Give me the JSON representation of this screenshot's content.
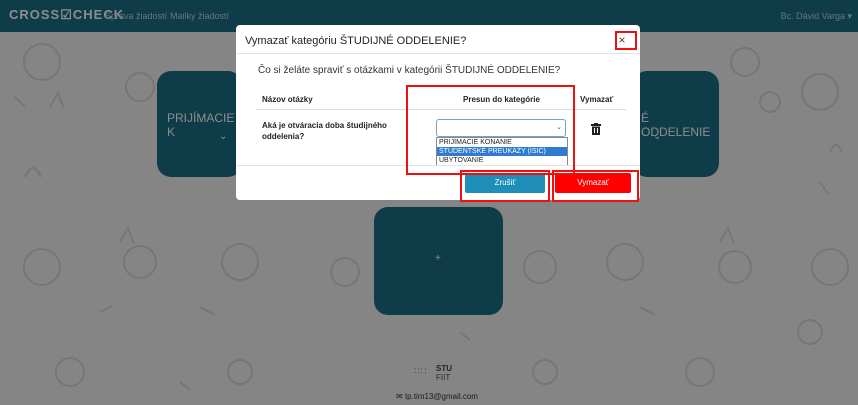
{
  "navbar": {
    "brand": "CROSS☑CHECK",
    "links": [
      "Správa žiadostí",
      "Mailky žiadostí"
    ],
    "user": "Bc. Dávid Varga ▾"
  },
  "tiles": {
    "left_label": "PRIJÍMACIE K",
    "right_label": "É ODDELENIE",
    "add_label": "+"
  },
  "footer": {
    "logo_top": "STU",
    "logo_bottom": "FIIT",
    "email": "tp.tim13@gmail.com"
  },
  "modal": {
    "title": "Vymazať kategóriu ŠTUDIJNÉ ODDELENIE?",
    "close": "×",
    "question": "Čo si želáte spraviť s otázkami v kategórii ŠTUDIJNÉ ODDELENIE?",
    "table": {
      "headers": [
        "Názov otázky",
        "Presun do kategórie",
        "Vymazať"
      ],
      "row": {
        "question": "Aká je otváracia doba študijného oddelenia?",
        "select_value": ""
      }
    },
    "dropdown_options": [
      "PRIJÍMACIE KONANIE",
      "ŠTUDENTSKÉ PREUKAZY (ISIC)",
      "UBYTOVANIE"
    ],
    "cancel_label": "Zrušiť",
    "delete_label": "Vymazať"
  },
  "colors": {
    "brand": "#1a6f86",
    "cancel": "#1f8fb9",
    "delete": "#ff0000",
    "highlight": "#e11111",
    "selected_option": "#2f7bd2"
  }
}
